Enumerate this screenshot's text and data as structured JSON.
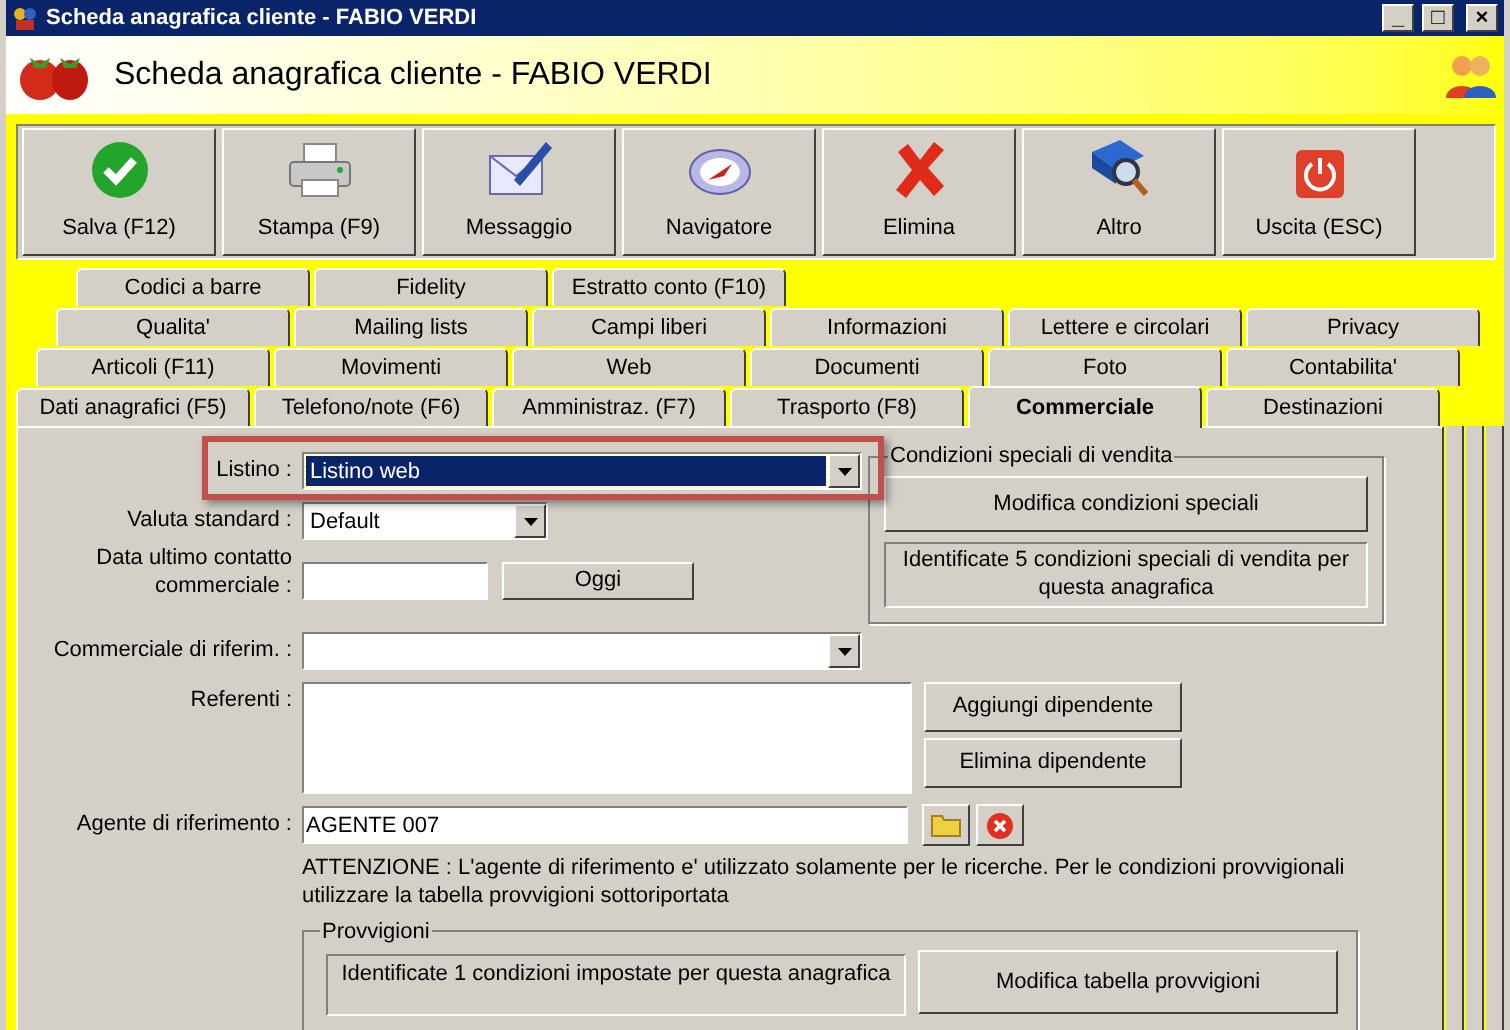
{
  "window": {
    "title": "Scheda anagrafica cliente - FABIO VERDI",
    "controls": [
      "_",
      "□",
      "×"
    ]
  },
  "header": {
    "title": "Scheda anagrafica cliente - FABIO VERDI"
  },
  "toolbar": [
    {
      "kind": "save",
      "label": "Salva (F12)"
    },
    {
      "kind": "print",
      "label": "Stampa (F9)"
    },
    {
      "kind": "message",
      "label": "Messaggio"
    },
    {
      "kind": "navigator",
      "label": "Navigatore"
    },
    {
      "kind": "delete",
      "label": "Elimina"
    },
    {
      "kind": "more",
      "label": "Altro"
    },
    {
      "kind": "exit",
      "label": "Uscita (ESC)"
    }
  ],
  "tab_rows": [
    [
      {
        "label": "Codici a barre",
        "selected": false
      },
      {
        "label": "Fidelity",
        "selected": false
      },
      {
        "label": "Estratto conto (F10)",
        "selected": false
      }
    ],
    [
      {
        "label": "Qualita'",
        "selected": false
      },
      {
        "label": "Mailing lists",
        "selected": false
      },
      {
        "label": "Campi liberi",
        "selected": false
      },
      {
        "label": "Informazioni",
        "selected": false
      },
      {
        "label": "Lettere e circolari",
        "selected": false
      },
      {
        "label": "Privacy",
        "selected": false
      }
    ],
    [
      {
        "label": "Articoli (F11)",
        "selected": false
      },
      {
        "label": "Movimenti",
        "selected": false
      },
      {
        "label": "Web",
        "selected": false
      },
      {
        "label": "Documenti",
        "selected": false
      },
      {
        "label": "Foto",
        "selected": false
      },
      {
        "label": "Contabilita'",
        "selected": false
      }
    ],
    [
      {
        "label": "Dati anagrafici (F5)",
        "selected": false
      },
      {
        "label": "Telefono/note (F6)",
        "selected": false
      },
      {
        "label": "Amministraz. (F7)",
        "selected": false
      },
      {
        "label": "Trasporto (F8)",
        "selected": false
      },
      {
        "label": "Commerciale",
        "selected": true
      },
      {
        "label": "Destinazioni",
        "selected": false
      }
    ]
  ],
  "form": {
    "listino": {
      "label": "Listino :",
      "value": "Listino web",
      "highlighted": true
    },
    "valuta": {
      "label": "Valuta standard :",
      "value": "Default"
    },
    "data_contatto": {
      "label_lines": [
        "Data ultimo contatto",
        "commerciale :"
      ],
      "button": "Oggi"
    },
    "condizioni": {
      "title": "Condizioni speciali di vendita",
      "button": "Modifica condizioni speciali",
      "info": "Identificate 5 condizioni speciali di vendita per questa anagrafica"
    },
    "commerciale": {
      "label": "Commerciale di riferim. :"
    },
    "referenti": {
      "label": "Referenti :",
      "buttons": [
        "Aggiungi dipendente",
        "Elimina dipendente"
      ]
    },
    "agente": {
      "label": "Agente di riferimento :",
      "value": "AGENTE 007"
    },
    "attenzione": "ATTENZIONE : L'agente di riferimento e' utilizzato solamente per le ricerche. Per le condizioni provvigionali utilizzare la tabella provvigioni sottoriportata",
    "provvigioni": {
      "title": "Provvigioni",
      "info": "Identificate 1 condizioni impostate per questa anagrafica",
      "button": "Modifica tabella provvigioni"
    }
  }
}
